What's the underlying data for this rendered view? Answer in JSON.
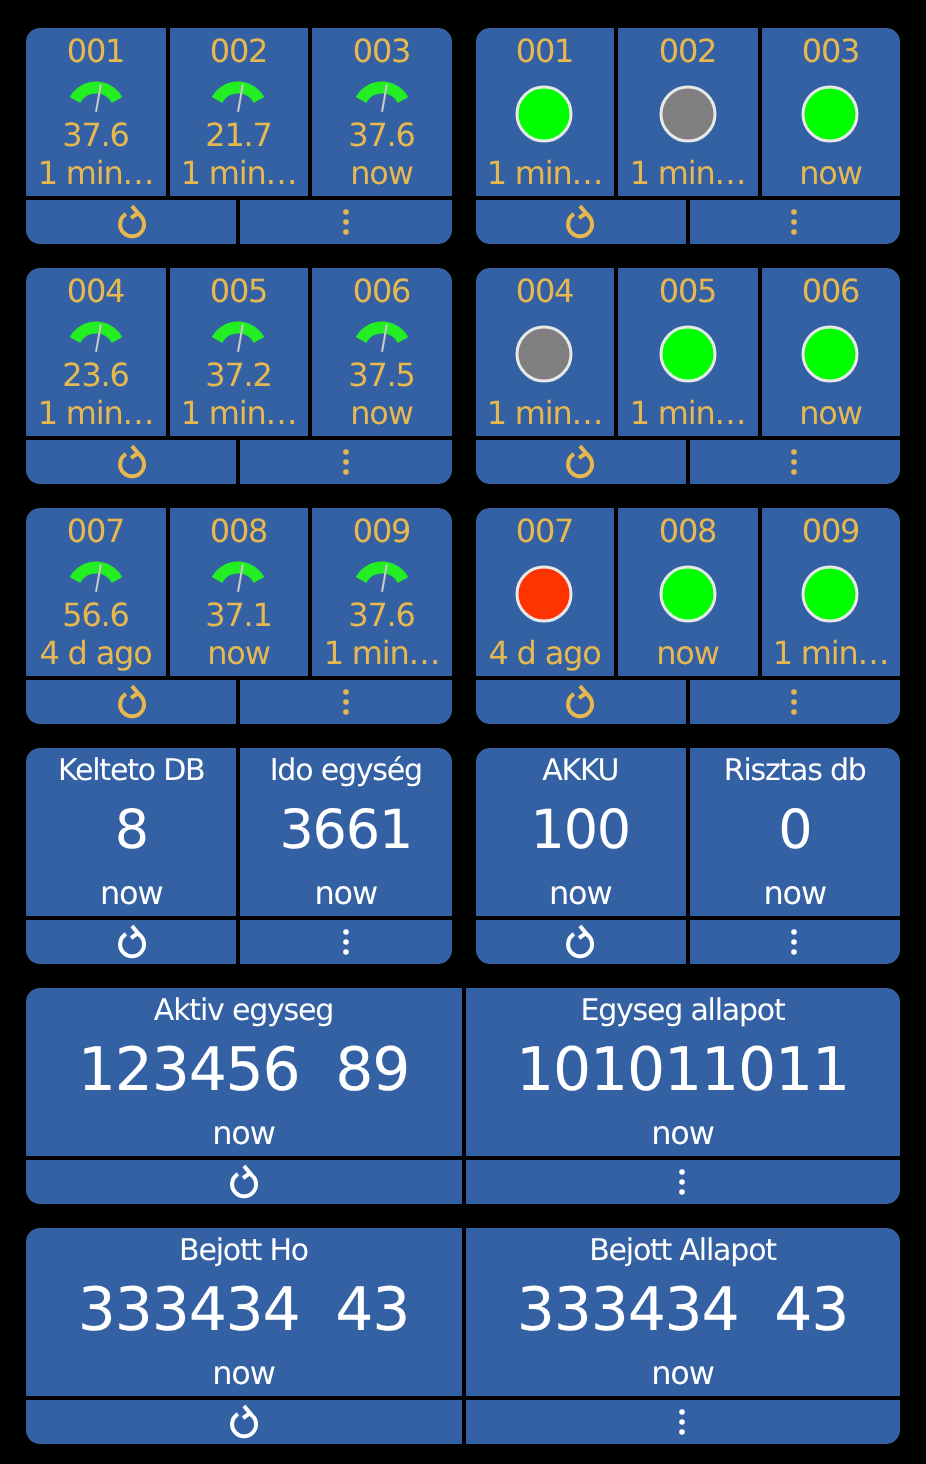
{
  "widgets": [
    {
      "kind": "gauges",
      "tiles": [
        {
          "label": "001",
          "value": "37.6",
          "time": "1 min…"
        },
        {
          "label": "002",
          "value": "21.7",
          "time": "1 min…"
        },
        {
          "label": "003",
          "value": "37.6",
          "time": "now"
        }
      ]
    },
    {
      "kind": "dots",
      "tiles": [
        {
          "label": "001",
          "color": "#00ff00",
          "time": "1 min…"
        },
        {
          "label": "002",
          "color": "#808080",
          "time": "1 min…"
        },
        {
          "label": "003",
          "color": "#00ff00",
          "time": "now"
        }
      ]
    },
    {
      "kind": "gauges",
      "tiles": [
        {
          "label": "004",
          "value": "23.6",
          "time": "1 min…"
        },
        {
          "label": "005",
          "value": "37.2",
          "time": "1 min…"
        },
        {
          "label": "006",
          "value": "37.5",
          "time": "now"
        }
      ]
    },
    {
      "kind": "dots",
      "tiles": [
        {
          "label": "004",
          "color": "#808080",
          "time": "1 min…"
        },
        {
          "label": "005",
          "color": "#00ff00",
          "time": "1 min…"
        },
        {
          "label": "006",
          "color": "#00ff00",
          "time": "now"
        }
      ]
    },
    {
      "kind": "gauges",
      "tiles": [
        {
          "label": "007",
          "value": "56.6",
          "time": "4 d ago"
        },
        {
          "label": "008",
          "value": "37.1",
          "time": "now"
        },
        {
          "label": "009",
          "value": "37.6",
          "time": "1 min…"
        }
      ]
    },
    {
      "kind": "dots",
      "tiles": [
        {
          "label": "007",
          "color": "#ff3300",
          "time": "4 d ago"
        },
        {
          "label": "008",
          "color": "#00ff00",
          "time": "now"
        },
        {
          "label": "009",
          "color": "#00ff00",
          "time": "1 min…"
        }
      ]
    },
    {
      "kind": "stats",
      "tiles": [
        {
          "label": "Kelteto DB",
          "value": "8",
          "time": "now"
        },
        {
          "label": "Ido egység",
          "value": "3661",
          "time": "now"
        }
      ]
    },
    {
      "kind": "stats",
      "tiles": [
        {
          "label": "AKKU",
          "value": "100",
          "time": "now"
        },
        {
          "label": "Risztas db",
          "value": "0",
          "time": "now"
        }
      ]
    },
    {
      "kind": "wide",
      "tiles": [
        {
          "label": "Aktiv egyseg",
          "value": "123456  89",
          "time": "now"
        },
        {
          "label": "Egyseg allapot",
          "value": "101011011",
          "time": "now"
        }
      ]
    },
    {
      "kind": "wide",
      "tiles": [
        {
          "label": "Bejott Ho",
          "value": "333434  43",
          "time": "now"
        },
        {
          "label": "Bejott Allapot",
          "value": "333434  43",
          "time": "now"
        }
      ]
    }
  ]
}
